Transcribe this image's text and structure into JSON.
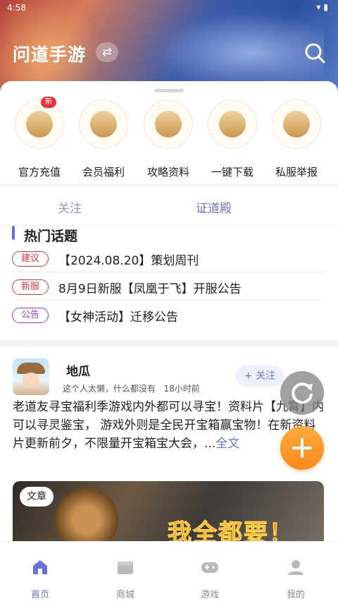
{
  "status_bar": {
    "time": "4:58"
  },
  "header": {
    "app_title": "问道手游"
  },
  "quick_actions": [
    {
      "label": "官方充值",
      "icon": "gold-ingot-icon",
      "badge": "新"
    },
    {
      "label": "会员福利",
      "icon": "gift-box-icon"
    },
    {
      "label": "攻略资料",
      "icon": "yin-yang-icon"
    },
    {
      "label": "一键下载",
      "icon": "download-icon"
    },
    {
      "label": "私服举报",
      "icon": "warning-icon"
    }
  ],
  "tabs": [
    {
      "label": "关注",
      "active": false
    },
    {
      "label": "证道殿",
      "active": true
    }
  ],
  "hot_topics": {
    "title": "热门话题",
    "items": [
      {
        "tag": "建议",
        "tag_color": "#e8333a",
        "text": "【2024.08.20】策划周刊"
      },
      {
        "tag": "新服",
        "tag_color": "#e8333a",
        "text": "8月9日新服【凤凰于飞】开服公告"
      },
      {
        "tag": "公告",
        "tag_color": "#a23ad8",
        "text": "【女神活动】迁移公告"
      }
    ]
  },
  "post": {
    "user_name": "地瓜",
    "signature": "这个人太懒，什么都没有",
    "time_ago": "18小时前",
    "follow_label": "+ 关注",
    "text": "老道友寻宝福利季游戏内外都可以寻宝！资料片【九霄】内可以寻灵鉴宝， 游戏外则是全民开宝箱赢宝物！在新资料片更新前夕，不限量开宝箱宝大会，...",
    "full_link": "全文",
    "image_tag": "文章",
    "image_caption": "我全都要！"
  },
  "bottom_nav": [
    {
      "label": "首页",
      "icon": "home-icon",
      "active": true
    },
    {
      "label": "商城",
      "icon": "shop-icon",
      "active": false
    },
    {
      "label": "游戏",
      "icon": "gamepad-icon",
      "active": false
    },
    {
      "label": "我的",
      "icon": "profile-icon",
      "active": false
    }
  ],
  "colors": {
    "accent": "#6b73d9",
    "fab": "#f98a1a",
    "badge_red": "#e8333a"
  }
}
